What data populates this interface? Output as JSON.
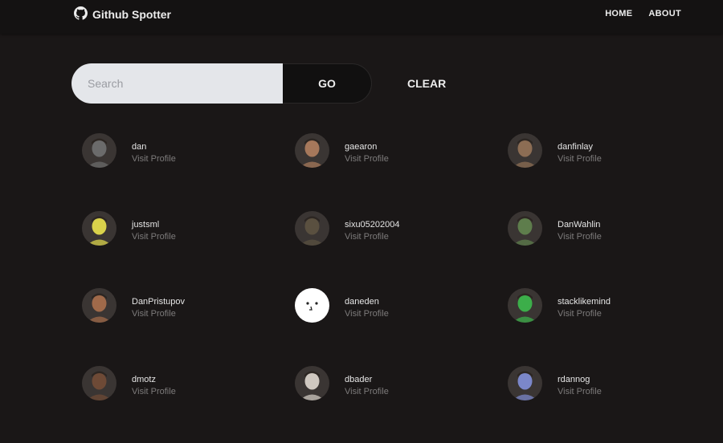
{
  "navbar": {
    "brand": "Github Spotter",
    "links": [
      "HOME",
      "ABOUT"
    ]
  },
  "search": {
    "placeholder": "Search",
    "value": "",
    "go_label": "GO",
    "clear_label": "CLEAR"
  },
  "users": [
    {
      "username": "dan",
      "visit_label": "Visit Profile",
      "avatar_color": "#6b6b6b"
    },
    {
      "username": "gaearon",
      "visit_label": "Visit Profile",
      "avatar_color": "#a6785b"
    },
    {
      "username": "danfinlay",
      "visit_label": "Visit Profile",
      "avatar_color": "#8c6d54"
    },
    {
      "username": "justsml",
      "visit_label": "Visit Profile",
      "avatar_color": "#d9d24b"
    },
    {
      "username": "sixu05202004",
      "visit_label": "Visit Profile",
      "avatar_color": "#5a5040"
    },
    {
      "username": "DanWahlin",
      "visit_label": "Visit Profile",
      "avatar_color": "#5e7d4c"
    },
    {
      "username": "DanPristupov",
      "visit_label": "Visit Profile",
      "avatar_color": "#a06a4a"
    },
    {
      "username": "daneden",
      "visit_label": "Visit Profile",
      "avatar_color": "#ffffff"
    },
    {
      "username": "stacklikemind",
      "visit_label": "Visit Profile",
      "avatar_color": "#3cae4a"
    },
    {
      "username": "dmotz",
      "visit_label": "Visit Profile",
      "avatar_color": "#6e4a36"
    },
    {
      "username": "dbader",
      "visit_label": "Visit Profile",
      "avatar_color": "#cfc8c0"
    },
    {
      "username": "rdannog",
      "visit_label": "Visit Profile",
      "avatar_color": "#7b87c9"
    }
  ]
}
